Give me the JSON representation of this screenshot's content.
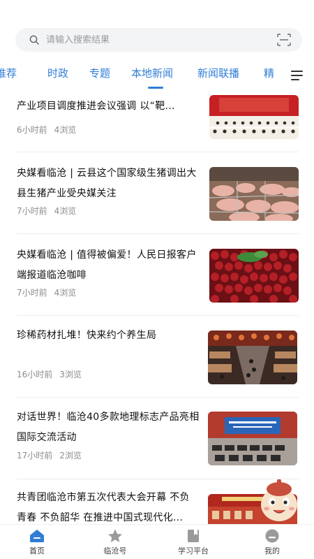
{
  "search": {
    "placeholder": "请输入搜索结果"
  },
  "tabs": [
    {
      "label": "推荐"
    },
    {
      "label": "时政"
    },
    {
      "label": "专题"
    },
    {
      "label": "本地新闻"
    },
    {
      "label": "新闻联播"
    },
    {
      "label": "精"
    }
  ],
  "active_tab": "本地新闻",
  "colors": {
    "accent": "#2f7dd6",
    "meta": "#8c8c8c"
  },
  "articles": [
    {
      "title": "产业项目调度推进会议强调 以“靶...",
      "time": "6小时前",
      "views": "4浏览"
    },
    {
      "title": "央媒看临沧 | 云县这个国家级生猪调出大县生猪产业受央媒关注",
      "time": "7小时前",
      "views": "4浏览"
    },
    {
      "title": "央媒看临沧 | 值得被偏爱！人民日报客户端报道临沧咖啡",
      "time": "7小时前",
      "views": "4浏览"
    },
    {
      "title": "珍稀药材扎堆！快来约个养生局",
      "time": "16小时前",
      "views": "3浏览"
    },
    {
      "title": "对话世界！临沧40多款地理标志产品亮相国际交流活动",
      "time": "17小时前",
      "views": "2浏览"
    },
    {
      "title": "共青团临沧市第五次代表大会开幕 不负青春 不负韶华 在推进中国式现代化...",
      "time": "",
      "views": ""
    }
  ],
  "bottom_nav": [
    {
      "label": "首页",
      "icon": "home-icon"
    },
    {
      "label": "临沧号",
      "icon": "star-icon"
    },
    {
      "label": "学习平台",
      "icon": "book-icon"
    },
    {
      "label": "我的",
      "icon": "profile-icon"
    }
  ]
}
